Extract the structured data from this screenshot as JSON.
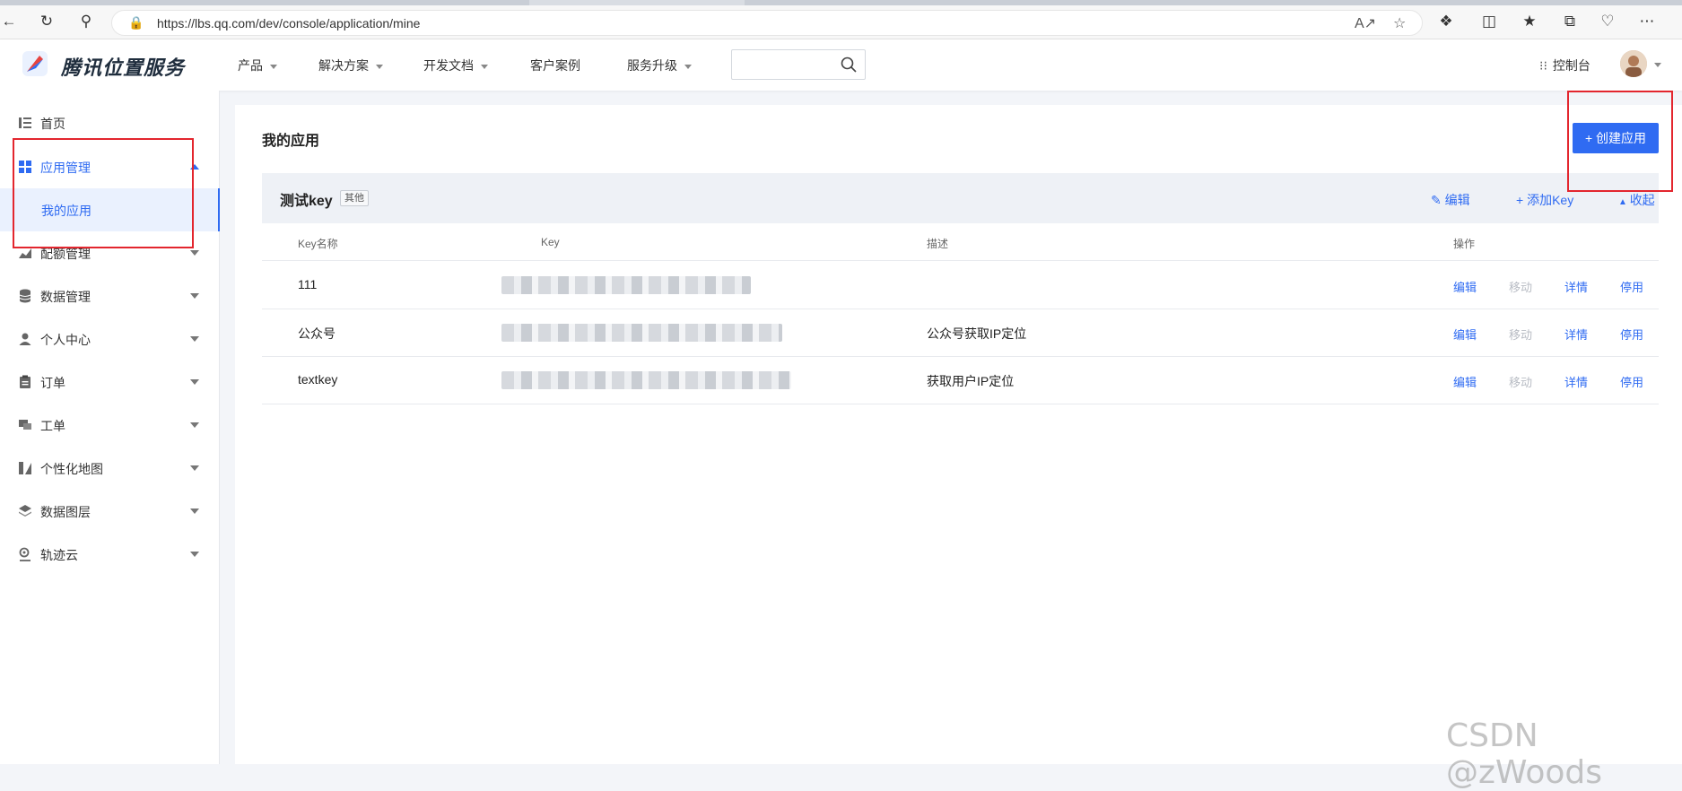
{
  "browser": {
    "url": "https://lbs.qq.com/dev/console/application/mine"
  },
  "header": {
    "brand": "腾讯位置服务",
    "nav": [
      "产品",
      "解决方案",
      "开发文档",
      "客户案例",
      "服务升级"
    ],
    "console_label": "控制台"
  },
  "sidebar": {
    "items": [
      {
        "label": "首页",
        "icon": "list-icon"
      },
      {
        "label": "应用管理",
        "icon": "grid-icon"
      },
      {
        "label": "配额管理",
        "icon": "chart-icon"
      },
      {
        "label": "数据管理",
        "icon": "database-icon"
      },
      {
        "label": "个人中心",
        "icon": "user-icon"
      },
      {
        "label": "订单",
        "icon": "clipboard-icon"
      },
      {
        "label": "工单",
        "icon": "chat-icon"
      },
      {
        "label": "个性化地图",
        "icon": "map-style-icon"
      },
      {
        "label": "数据图层",
        "icon": "layers-icon"
      },
      {
        "label": "轨迹云",
        "icon": "track-icon"
      }
    ],
    "sub_item": "我的应用"
  },
  "main": {
    "title": "我的应用",
    "create_button": "+ 创建应用",
    "key_group": {
      "name": "测试key",
      "tag": "其他",
      "edit": "编辑",
      "add_key": "添加Key",
      "collapse": "收起"
    },
    "table": {
      "columns": [
        "Key名称",
        "Key",
        "描述",
        "操作"
      ],
      "rows": [
        {
          "name": "111",
          "desc": ""
        },
        {
          "name": "公众号",
          "desc": "公众号获取IP定位"
        },
        {
          "name": "textkey",
          "desc": "获取用户IP定位"
        }
      ],
      "ops": [
        "编辑",
        "移动",
        "详情",
        "停用"
      ]
    }
  },
  "watermark": "CSDN @zWoods",
  "colors": {
    "accent": "#2f6bf2",
    "highlight_box": "#e3262e"
  }
}
